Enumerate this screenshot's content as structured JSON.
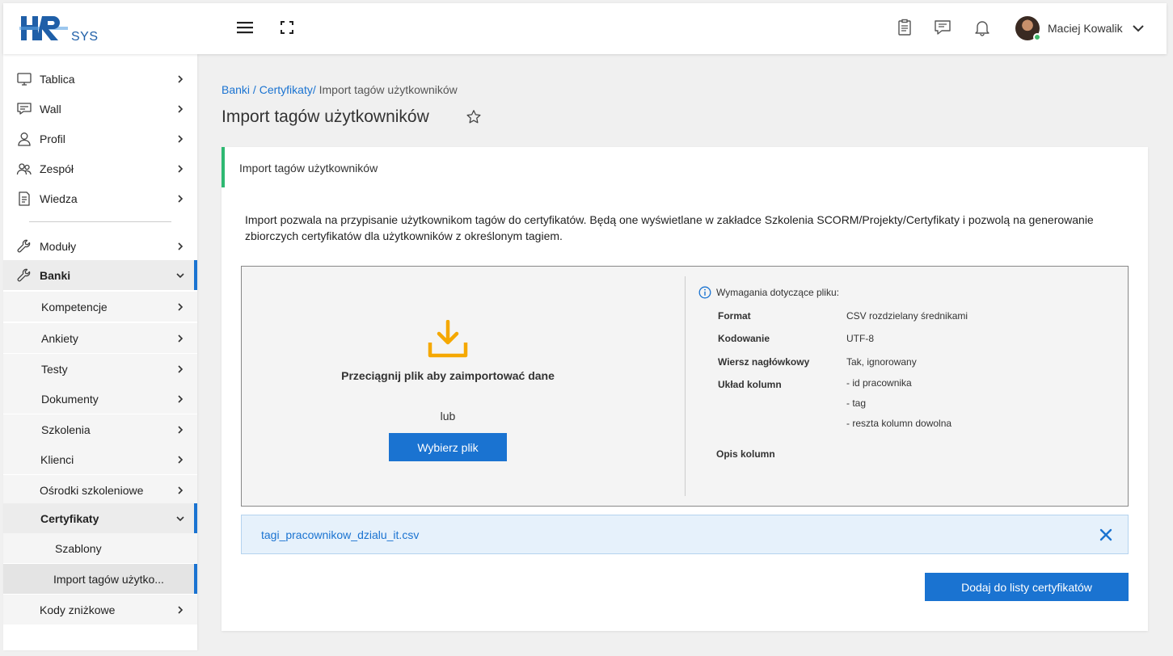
{
  "header": {
    "logo_text": "HR",
    "logo_suffix": "SYS",
    "user_name": "Maciej Kowalik"
  },
  "sidebar": {
    "items": [
      {
        "label": "Tablica",
        "icon": "monitor-icon"
      },
      {
        "label": "Wall",
        "icon": "chat-icon"
      },
      {
        "label": "Profil",
        "icon": "user-icon"
      },
      {
        "label": "Zespół",
        "icon": "team-icon"
      },
      {
        "label": "Wiedza",
        "icon": "document-icon"
      },
      {
        "label": "Moduły",
        "icon": "wrench-icon"
      },
      {
        "label": "Banki",
        "icon": "wrench-icon",
        "expanded": true
      },
      {
        "label": "Kompetencje"
      },
      {
        "label": "Ankiety"
      },
      {
        "label": "Testy"
      },
      {
        "label": "Dokumenty"
      },
      {
        "label": "Szkolenia"
      },
      {
        "label": "Klienci"
      },
      {
        "label": "Ośrodki szkoleniowe"
      },
      {
        "label": "Certyfikaty",
        "expanded": true
      },
      {
        "label": "Szablony"
      },
      {
        "label": "Import tagów użytko..."
      },
      {
        "label": "Kody zniżkowe"
      }
    ]
  },
  "breadcrumb": {
    "part1": "Banki",
    "sep1": " / ",
    "part2": "Certyfikaty",
    "sep2": "/ ",
    "current": "Import tagów użytkowników"
  },
  "page_title": "Import tagów użytkowników",
  "card": {
    "title": "Import tagów użytkowników",
    "description": "Import pozwala na przypisanie użytkownikom tagów do certyfikatów. Będą one wyświetlane w zakładce Szkolenia SCORM/Projekty/Certyfikaty i pozwolą na generowanie zbiorczych certyfikatów dla użytkowników z określonym tagiem."
  },
  "dropzone": {
    "text": "Przeciągnij plik aby zaimportować dane",
    "or": "lub",
    "button": "Wybierz plik"
  },
  "requirements": {
    "title": "Wymagania dotyczące pliku:",
    "format_label": "Format",
    "format_value": "CSV rozdzielany średnikami",
    "encoding_label": "Kodowanie",
    "encoding_value": "UTF-8",
    "header_label": "Wiersz nagłówkowy",
    "header_value": "Tak, ignorowany",
    "columns_label": "Układ kolumn",
    "columns": [
      "- id pracownika",
      "- tag",
      "- reszta kolumn dowolna"
    ],
    "desc_label": "Opis kolumn"
  },
  "file": {
    "name": "tagi_pracownikow_dzialu_it.csv"
  },
  "submit_button": "Dodaj do listy certyfikatów",
  "colors": {
    "accent": "#1a73d1",
    "success": "#2eb872",
    "logo": "#1f5fa8",
    "download": "#f5a800"
  }
}
